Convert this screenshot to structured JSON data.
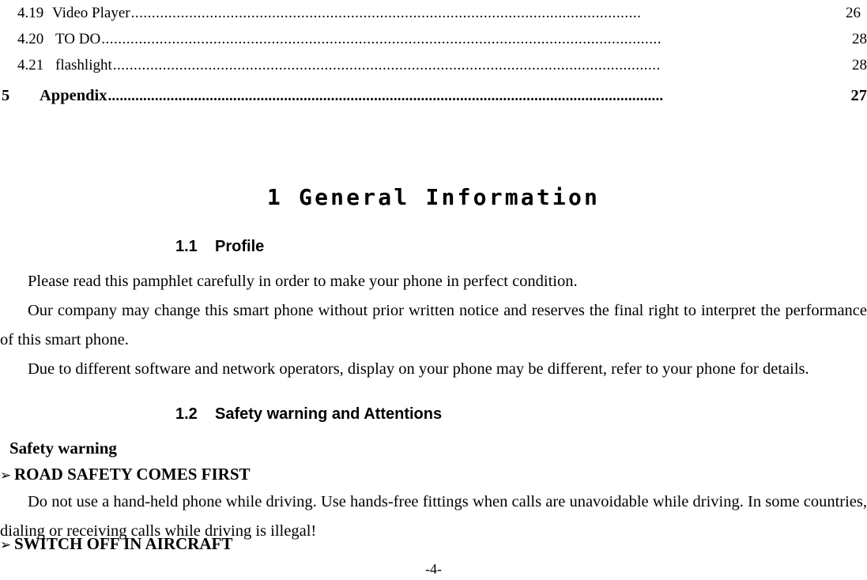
{
  "document": {
    "type": "user-manual-page",
    "footer_page_label": "-4-"
  },
  "toc": {
    "entries": [
      {
        "number": "4.19",
        "title": "Video Player",
        "leader": "...........................................................................................................................",
        "page": "26",
        "level": "sub"
      },
      {
        "number": "4.20",
        "title": "TO DO",
        "leader": ".......................................................................................................................................",
        "page": "28",
        "level": "sub"
      },
      {
        "number": "4.21",
        "title": "flashlight",
        "leader": "....................................................................................................................................",
        "page": "28",
        "level": "sub"
      },
      {
        "number": "5",
        "title": "Appendix",
        "leader": "..............................................................................................................................................",
        "page": "27",
        "level": "main"
      }
    ]
  },
  "chapter": {
    "title": "1 General Information"
  },
  "sections": [
    {
      "id": "1.1",
      "heading": "1.1    Profile",
      "paragraphs": [
        "Please read this pamphlet carefully in order to make your phone in perfect condition.",
        "Our company may change this smart phone without prior written notice and reserves the final right to interpret the performance of this smart phone.",
        "Due to different software and network operators, display on your phone may be different, refer to your phone for details."
      ]
    },
    {
      "id": "1.2",
      "heading": "1.2    Safety warning and Attentions",
      "subheading": "Safety warning",
      "bullets": [
        {
          "marker": "➢",
          "label": "ROAD SAFETY COMES FIRST",
          "body": "Do not use a hand-held phone while driving. Use hands-free fittings when calls are unavoidable while driving. In some countries, dialing or receiving calls while driving is illegal!"
        },
        {
          "marker": "➢",
          "label": "SWITCH OFF IN AIRCRAFT",
          "body": ""
        }
      ]
    }
  ]
}
